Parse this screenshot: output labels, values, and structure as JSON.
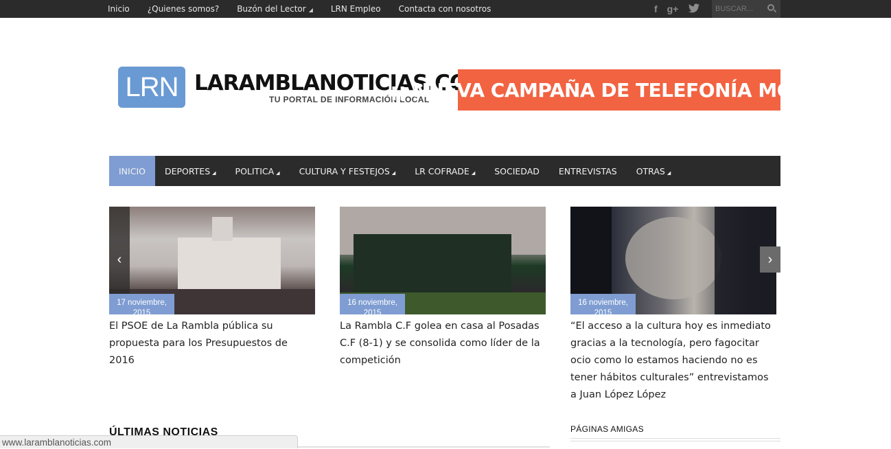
{
  "topbar": {
    "links": [
      "Inicio",
      "¿Quienes somos?",
      "Buzón del Lector",
      "LRN Empleo",
      "Contacta con nosotros"
    ],
    "social_icons": [
      "facebook-icon",
      "google-plus-icon",
      "twitter-icon"
    ],
    "search_placeholder": "BUSCAR..."
  },
  "header": {
    "logo_text": "LRN",
    "site_name": "LARAMBLANOTICIAS.COM",
    "tagline": "TU PORTAL DE INFORMACIÓN LOCAL",
    "banner": "¡¡ NUEVA CAMPAÑA DE TELEFONÍA MÓVIL !!"
  },
  "nav": {
    "items": [
      {
        "label": "INICIO"
      },
      {
        "label": "DEPORTES"
      },
      {
        "label": "POLITICA"
      },
      {
        "label": "CULTURA Y FESTEJOS"
      },
      {
        "label": "LR COFRADE"
      },
      {
        "label": "SOCIEDAD"
      },
      {
        "label": "ENTREVISTAS"
      },
      {
        "label": "OTRAS"
      }
    ]
  },
  "slider": {
    "slides": [
      {
        "date": "17 noviembre, 2015",
        "title": "El PSOE de La Rambla pública su propuesta para los Presupuestos de 2016"
      },
      {
        "date": "16 noviembre, 2015",
        "title": "La Rambla C.F golea en casa al Posadas C.F (8-1) y se consolida como líder de la competición"
      },
      {
        "date": "16 noviembre, 2015",
        "title": "“El acceso a la cultura hoy es inmediato gracias a la tecnología, pero fagocitar ocio como lo estamos haciendo no es tener hábitos culturales” entrevistamos a Juan López López"
      }
    ]
  },
  "sections": {
    "latest": "ÚLTIMAS NOTICIAS",
    "friends": "PÁGINAS AMIGAS"
  },
  "status_url": "www.laramblanoticias.com",
  "colors": {
    "accent": "#7f9dd2",
    "banner": "#f26341",
    "dark": "#2b2b2b"
  }
}
